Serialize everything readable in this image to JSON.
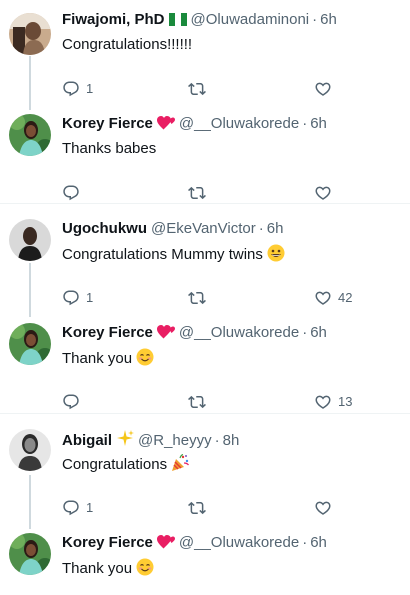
{
  "colors": {
    "text": "#0f1419",
    "secondary": "#536471",
    "thread_line": "#cfd9de",
    "divider": "#eff3f4",
    "heart_emoji": "#e91e63",
    "sparkle_emoji": "#f5c518"
  },
  "icons": {
    "reply": "speech-bubble-icon",
    "retweet": "retweet-arrows-icon",
    "like": "heart-outline-icon"
  },
  "tweets": [
    {
      "name": "Fiwajomi, PhD",
      "badge": "nigeria-flag",
      "handle": "@Oluwadaminoni",
      "dot": "·",
      "time": "6h",
      "text": "Congratulations!!!!!!",
      "replies": "1",
      "retweets": "",
      "likes": ""
    },
    {
      "name": "Korey Fierce",
      "badge": "two-hearts-emoji",
      "handle": "@__Oluwakorede",
      "dot": "·",
      "time": "6h",
      "text": "Thanks babes",
      "replies": "",
      "retweets": "",
      "likes": ""
    },
    {
      "name": "Ugochukwu",
      "badge": "",
      "handle": "@EkeVanVictor",
      "dot": "·",
      "time": "6h",
      "text": "Congratulations Mummy twins",
      "emoji": "grinning-face-emoji",
      "replies": "1",
      "retweets": "",
      "likes": "42"
    },
    {
      "name": "Korey Fierce",
      "badge": "two-hearts-emoji",
      "handle": "@__Oluwakorede",
      "dot": "·",
      "time": "6h",
      "text": "Thank you",
      "emoji": "smiling-face-emoji",
      "replies": "",
      "retweets": "",
      "likes": "13"
    },
    {
      "name": "Abigail",
      "badge": "sparkles-emoji",
      "handle": "@R_heyyy",
      "dot": "·",
      "time": "8h",
      "text": "Congratulations",
      "emoji": "party-popper-emoji",
      "replies": "1",
      "retweets": "",
      "likes": ""
    },
    {
      "name": "Korey Fierce",
      "badge": "two-hearts-emoji",
      "handle": "@__Oluwakorede",
      "dot": "·",
      "time": "6h",
      "text": "Thank you",
      "emoji": "smiling-face-emoji",
      "replies": "",
      "retweets": "",
      "likes": ""
    }
  ]
}
